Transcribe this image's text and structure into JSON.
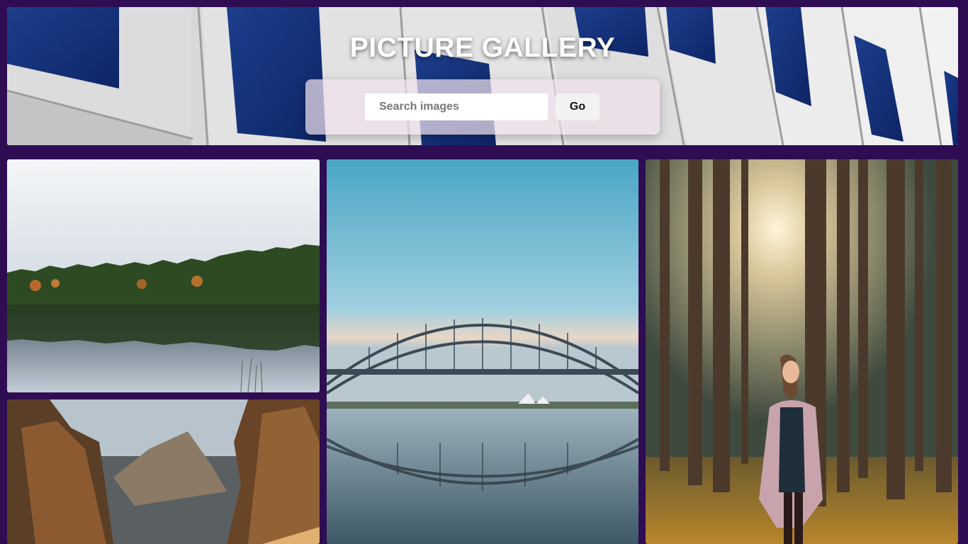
{
  "header": {
    "title": "PICTURE GALLERY",
    "search_placeholder": "Search images",
    "search_value": "",
    "go_label": "Go"
  },
  "colors": {
    "page_background": "#2e0d52",
    "header_panel_tint": "#f0e1eb"
  },
  "gallery": {
    "images": [
      {
        "subject": "forest lake reflection"
      },
      {
        "subject": "harbour bridge at dusk"
      },
      {
        "subject": "woman in pine forest"
      },
      {
        "subject": "rocky coastline"
      }
    ]
  }
}
